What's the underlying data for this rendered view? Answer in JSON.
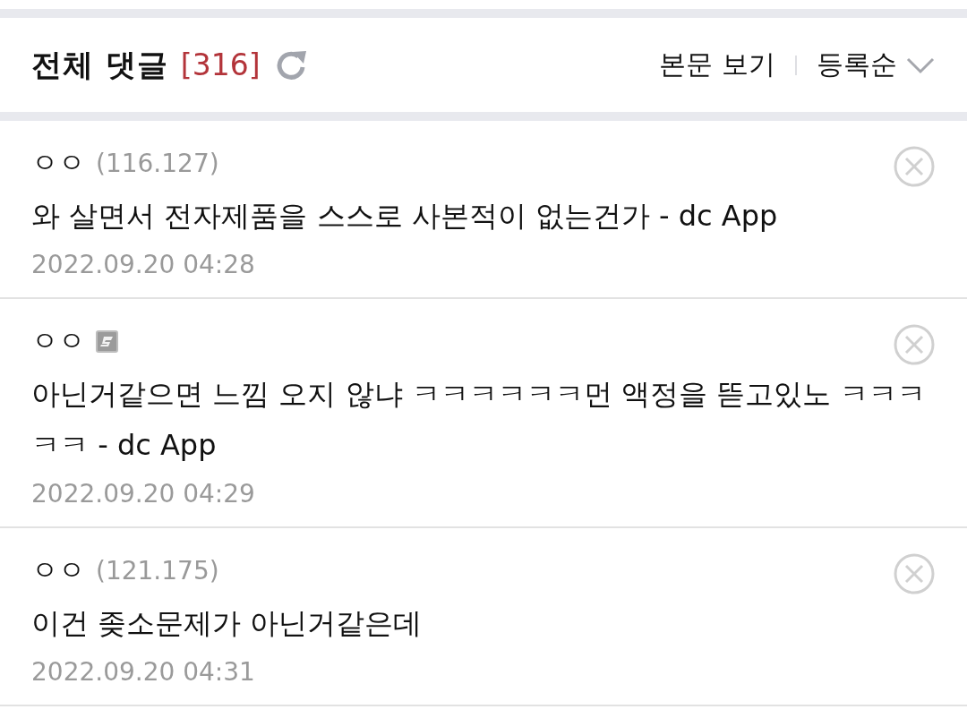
{
  "header": {
    "title": "전체 댓글",
    "count": "[316]",
    "actions": [
      {
        "kind": "link",
        "label": "본문 보기"
      },
      {
        "kind": "sort",
        "label": "등록순"
      }
    ]
  },
  "comments": [
    {
      "author": "ㅇㅇ",
      "kind": "ip",
      "ip": "(116.127)",
      "text": "와 살면서 전자제품을 스스로 사본적이 없는건가 - dc App",
      "date": "2022.09.20 04:28"
    },
    {
      "author": "ㅇㅇ",
      "kind": "badge",
      "text": "아닌거같으면 느낌 오지 않냐 ㅋㅋㅋㅋㅋㅋ먼 액정을 뜯고있노 ㅋㅋㅋㅋㅋ - dc App",
      "date": "2022.09.20 04:29"
    },
    {
      "author": "ㅇㅇ",
      "kind": "ip",
      "ip": "(121.175)",
      "text": "이건 좆소문제가 아닌거같은데",
      "date": "2022.09.20 04:31"
    }
  ]
}
